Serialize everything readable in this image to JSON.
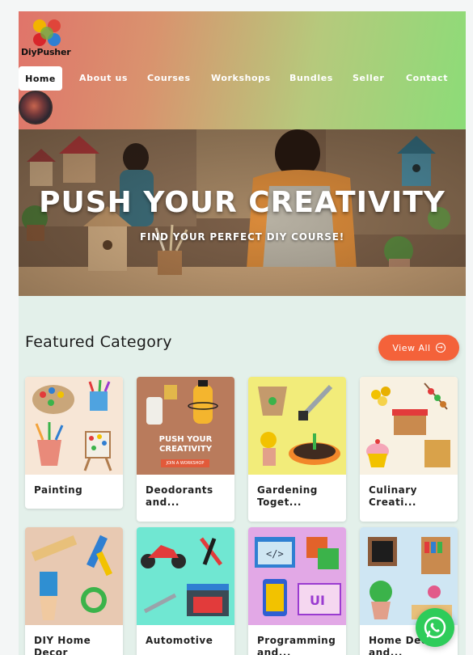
{
  "brand": {
    "name": "DiyPusher"
  },
  "nav": {
    "items": [
      {
        "label": "Home",
        "active": true
      },
      {
        "label": "About us"
      },
      {
        "label": "Courses"
      },
      {
        "label": "Workshops"
      },
      {
        "label": "Bundles"
      },
      {
        "label": "Seller"
      },
      {
        "label": "Contact"
      }
    ]
  },
  "hero": {
    "title": "PUSH YOUR CREATIVITY",
    "subtitle": "FIND YOUR PERFECT DIY COURSE!"
  },
  "featured": {
    "title": "Featured Category",
    "view_all_label": "View All",
    "categories": [
      {
        "label": "Painting",
        "bg": "#f7e6d6"
      },
      {
        "label": "Deodorants and...",
        "bg": "#b97b5c",
        "image_text": [
          "PUSH YOUR",
          "CREATIVITY",
          "JOIN A WORKSHOP"
        ]
      },
      {
        "label": "Gardening Toget...",
        "bg": "#f2ec7a"
      },
      {
        "label": "Culinary Creati...",
        "bg": "#f8f1e2"
      },
      {
        "label": "DIY Home Decor",
        "bg": "#e8c9b2"
      },
      {
        "label": "Automotive",
        "bg": "#70e7d2"
      },
      {
        "label": "Programming and...",
        "bg": "#e2a8e6"
      },
      {
        "label": "Home Decor and...",
        "bg": "#cfe6f3"
      }
    ]
  },
  "colors": {
    "accent": "#f4623a",
    "whatsapp": "#2ecc5a"
  }
}
